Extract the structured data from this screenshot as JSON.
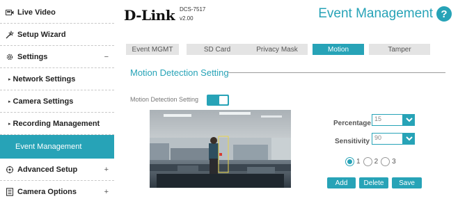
{
  "sidebar": {
    "items": [
      {
        "label": "Live Video",
        "icon": "video-icon"
      },
      {
        "label": "Setup Wizard",
        "icon": "wand-icon"
      },
      {
        "label": "Settings",
        "icon": "gear-icon",
        "sign": "−"
      },
      {
        "label": "Network Settings"
      },
      {
        "label": "Camera Settings"
      },
      {
        "label": "Recording Management"
      },
      {
        "label": "Event Management"
      },
      {
        "label": "Advanced Setup",
        "icon": "advanced-icon",
        "sign": "+"
      },
      {
        "label": "Camera Options",
        "icon": "document-icon",
        "sign": "+"
      }
    ]
  },
  "header": {
    "logo": "D-Link",
    "model": "DCS-7517",
    "version": "v2.00",
    "title": "Event Management",
    "help": "?"
  },
  "tabs": [
    {
      "label": "Event MGMT",
      "active": false
    },
    {
      "label": "SD Card",
      "active": false
    },
    {
      "label": "Privacy Mask",
      "active": false
    },
    {
      "label": "Motion",
      "active": true
    },
    {
      "label": "Tamper",
      "active": false
    }
  ],
  "section": {
    "title": "Motion Detection Setting",
    "toggle_label": "Motion Detection Setting",
    "toggle_on": true
  },
  "controls": {
    "percentage_label": "Percentage",
    "percentage_value": "15",
    "sensitivity_label": "Sensitivity",
    "sensitivity_value": "90",
    "radio_options": [
      "1",
      "2",
      "3"
    ],
    "radio_selected": "1",
    "add_label": "Add",
    "delete_label": "Delete",
    "save_label": "Save"
  },
  "colors": {
    "accent": "#27a3b7"
  }
}
